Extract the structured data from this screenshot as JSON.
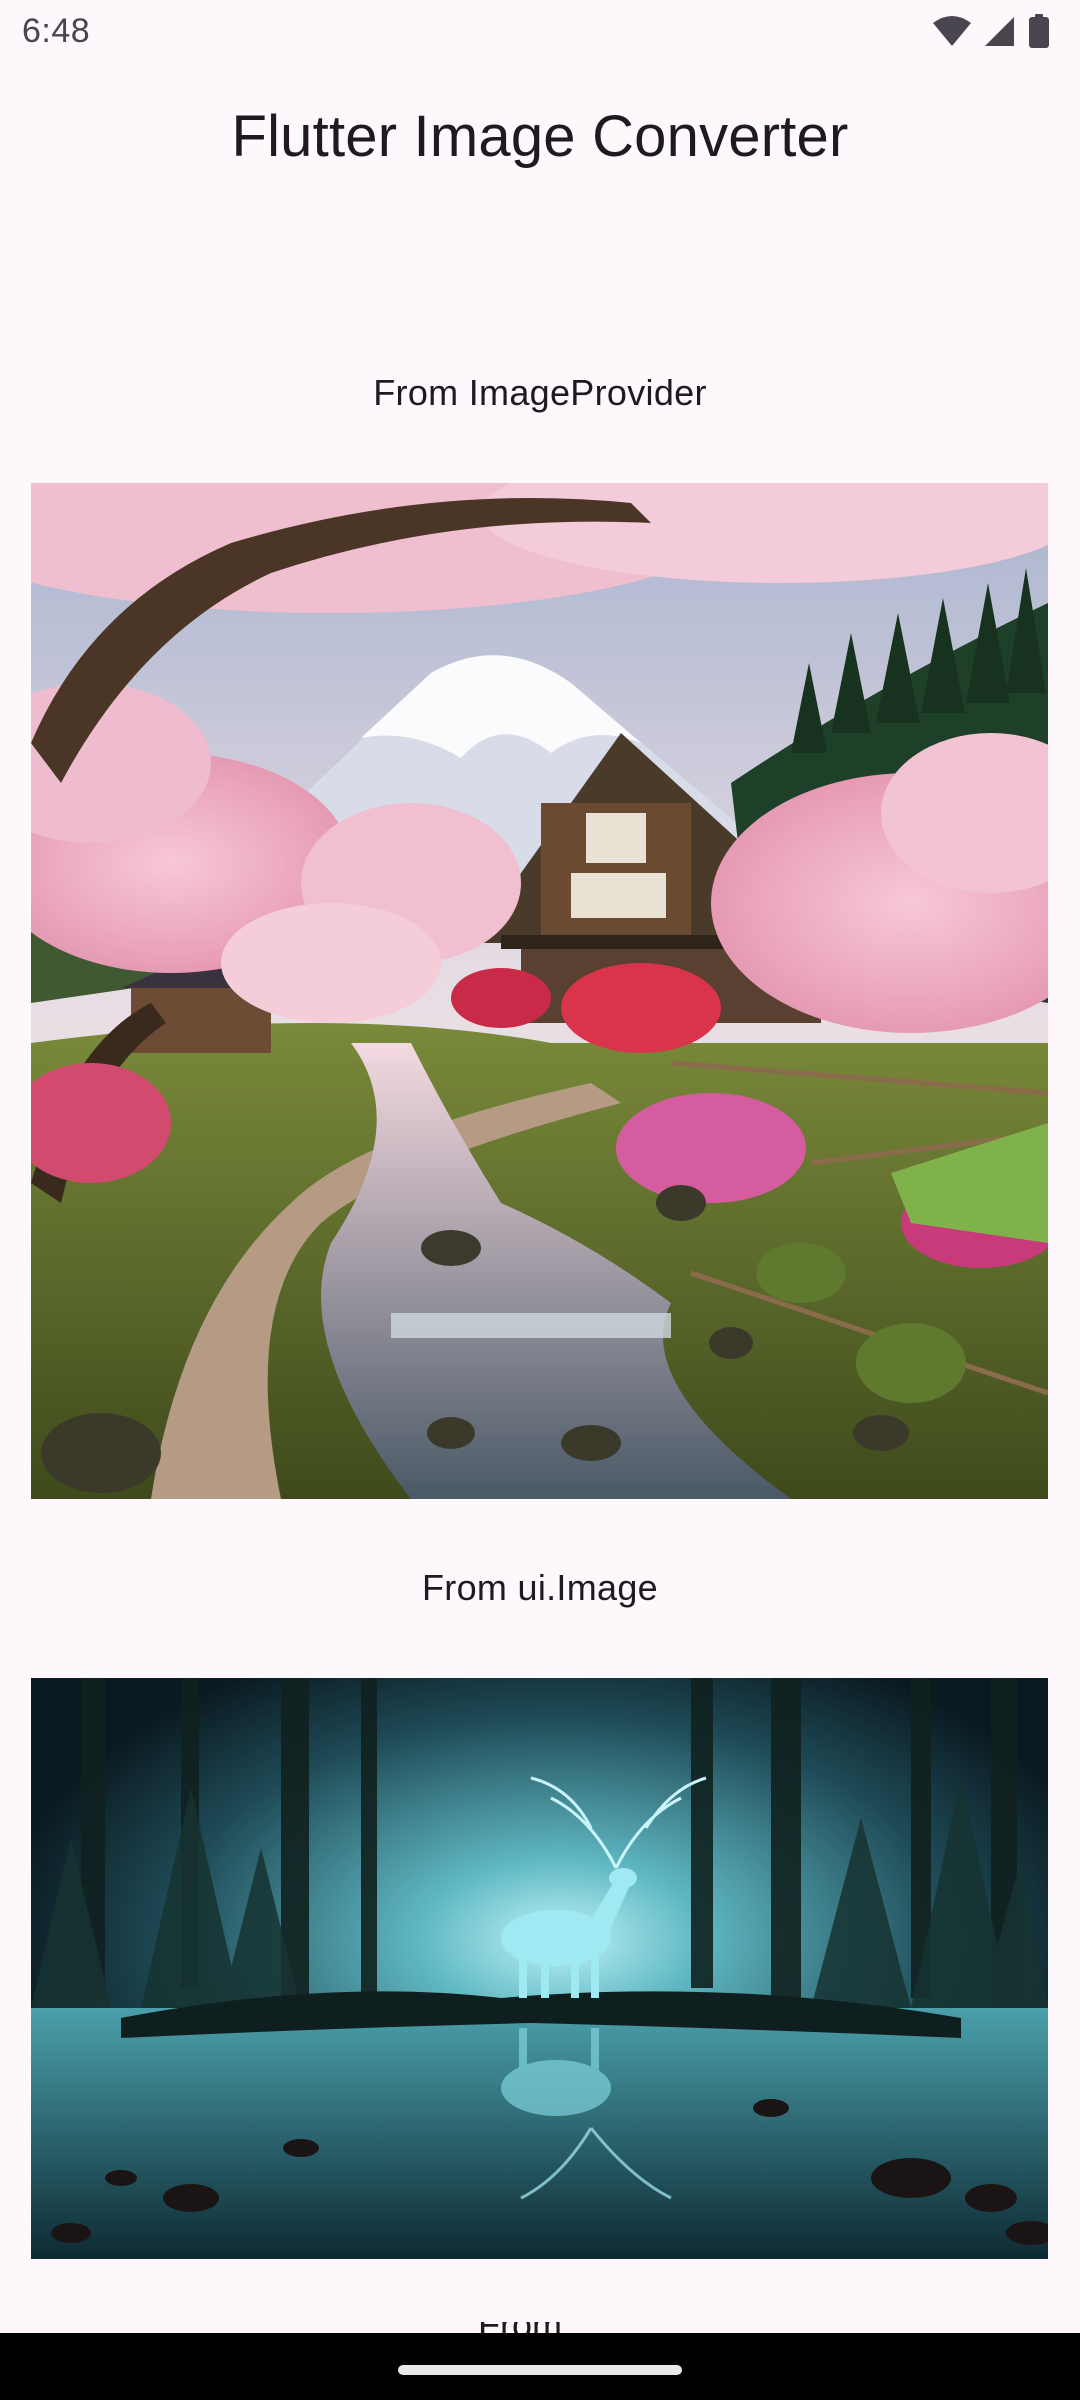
{
  "status_bar": {
    "time": "6:48",
    "icons": [
      "wifi-icon",
      "cellular-signal-icon",
      "battery-icon"
    ]
  },
  "app_bar": {
    "title": "Flutter Image Converter"
  },
  "sections": [
    {
      "label": "From ImageProvider",
      "image_description": "cherry-blossom-village-with-mount-fuji"
    },
    {
      "label": "From ui.Image",
      "image_description": "glowing-stag-in-misty-forest-lake"
    }
  ],
  "next_section_peek": {
    "label": "From ..."
  },
  "colors": {
    "background": "#fef7fb",
    "text": "#1d1b20",
    "nav_bar": "#000000"
  }
}
